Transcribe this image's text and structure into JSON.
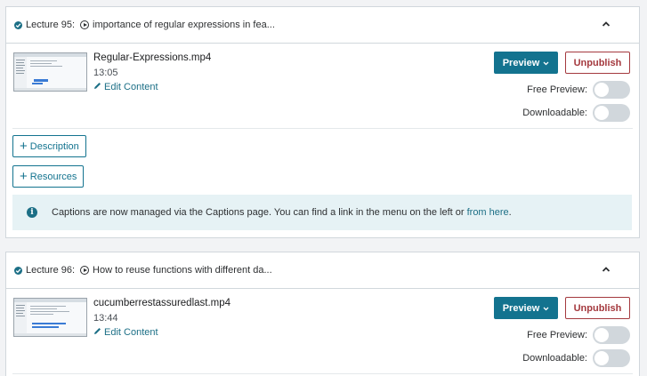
{
  "lectures": [
    {
      "label": "Lecture 95:",
      "title": "importance of regular expressions in fea...",
      "file_name": "Regular-Expressions.mp4",
      "duration": "13:05",
      "edit_label": "Edit Content",
      "preview_label": "Preview",
      "unpublish_label": "Unpublish",
      "free_preview_label": "Free Preview:",
      "downloadable_label": "Downloadable:",
      "free_preview_on": false,
      "downloadable_on": false
    },
    {
      "label": "Lecture 96:",
      "title": "How to reuse functions with different da...",
      "file_name": "cucumberrestassuredlast.mp4",
      "duration": "13:44",
      "edit_label": "Edit Content",
      "preview_label": "Preview",
      "unpublish_label": "Unpublish",
      "free_preview_label": "Free Preview:",
      "downloadable_label": "Downloadable:",
      "free_preview_on": false,
      "downloadable_on": false
    }
  ],
  "description_label": "Description",
  "resources_label": "Resources",
  "info": {
    "text": "Captions are now managed via the Captions page. You can find a link in the menu on the left or",
    "link": "from here",
    "suffix": "."
  },
  "colors": {
    "accent": "#13738f",
    "danger": "#a4393e",
    "info_bg": "#e6f2f5"
  }
}
